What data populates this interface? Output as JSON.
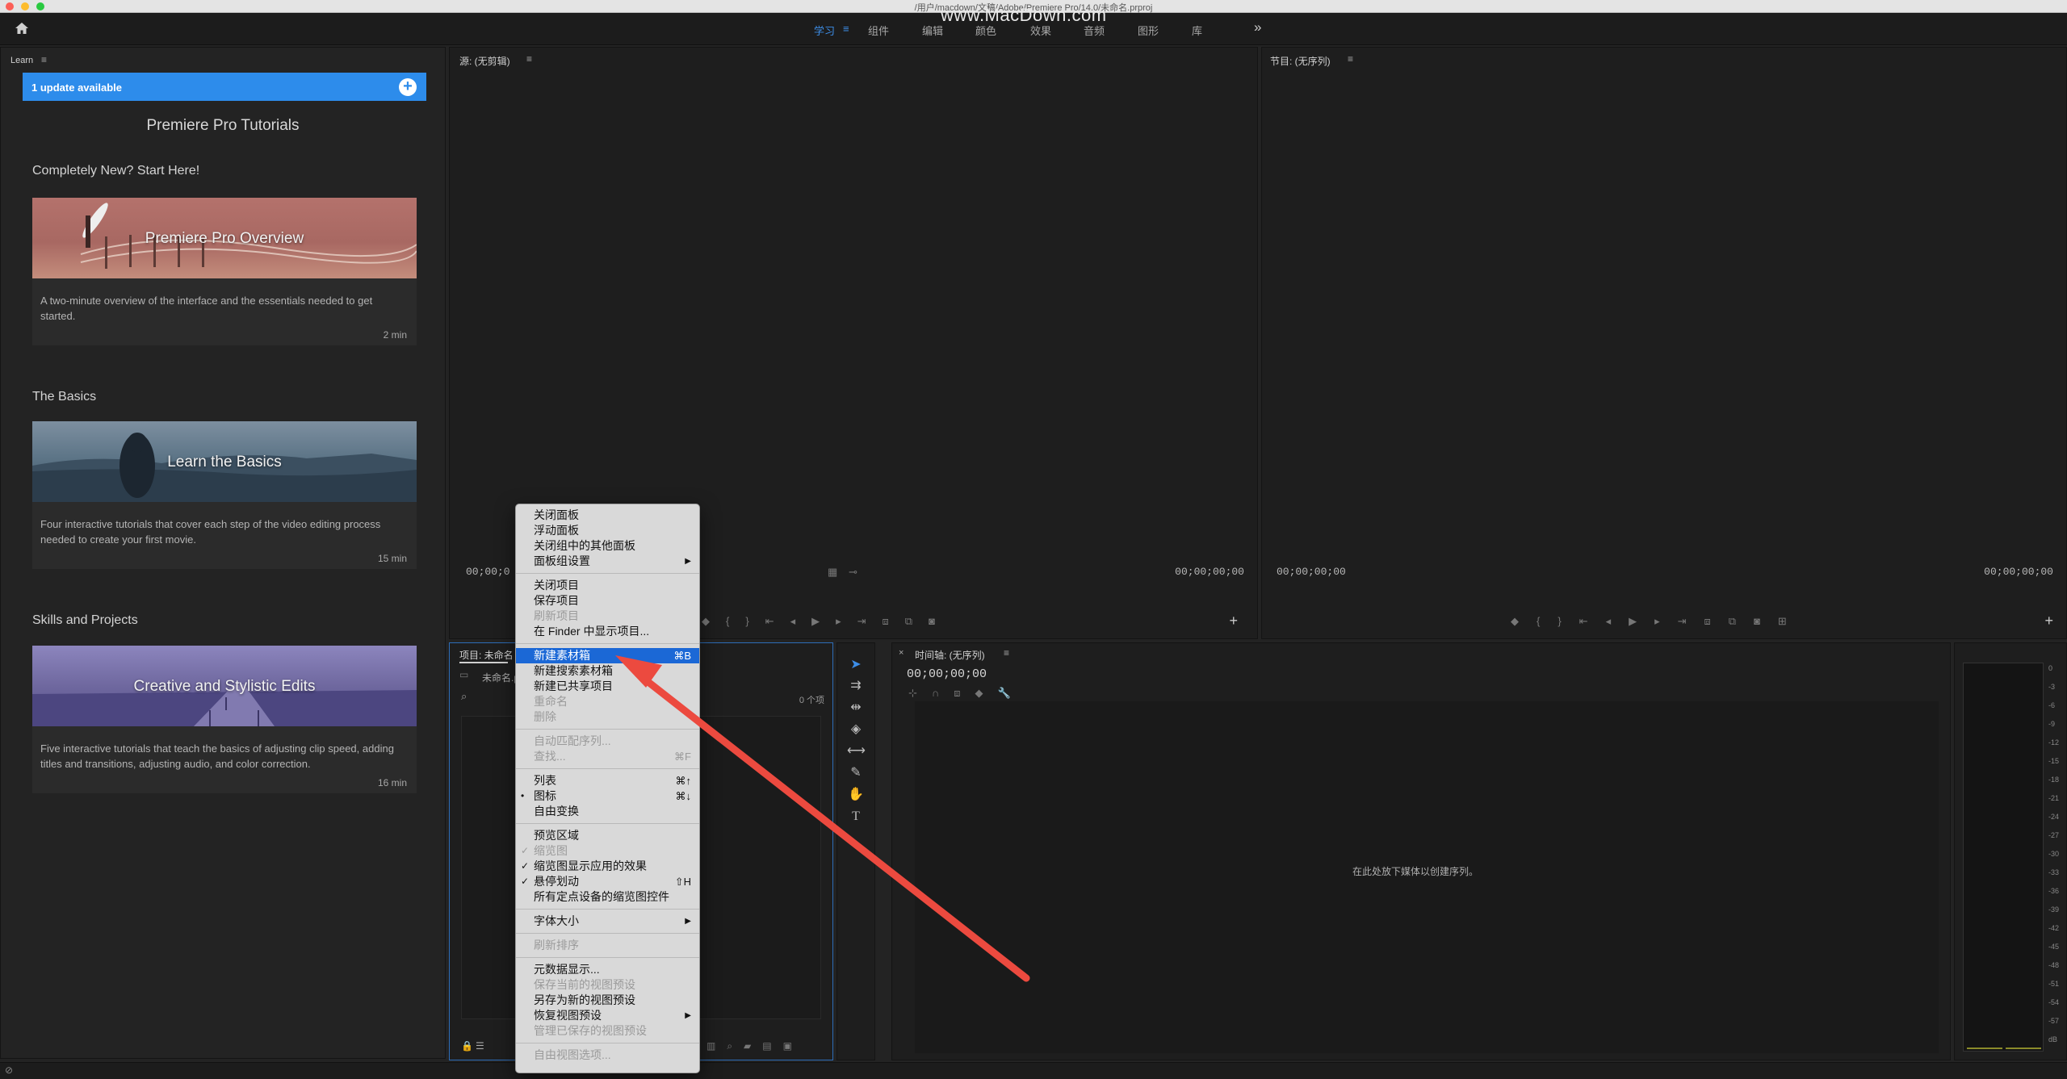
{
  "window": {
    "title": "/用户/macdown/文稿/Adobe/Premiere Pro/14.0/未命名.prproj",
    "watermark": "www.MacDown.com"
  },
  "workspaces": [
    "学习",
    "组件",
    "编辑",
    "颜色",
    "效果",
    "音频",
    "图形",
    "库"
  ],
  "workspace_menu_icon": "≡",
  "more_icon": "»",
  "learn": {
    "panel_title": "Learn",
    "update_banner": "1 update available",
    "heading": "Premiere Pro Tutorials",
    "sections": [
      {
        "title": "Completely New? Start Here!",
        "card_title": "Premiere Pro Overview",
        "desc": "A two-minute overview of the interface and the essentials needed to get started.",
        "duration": "2 min"
      },
      {
        "title": "The Basics",
        "card_title": "Learn the Basics",
        "desc": "Four interactive tutorials that cover each step of the video editing process needed to create your first movie.",
        "duration": "15 min"
      },
      {
        "title": "Skills and Projects",
        "card_title": "Creative and Stylistic Edits",
        "desc": "Five interactive tutorials that teach the basics of adjusting clip speed, adding titles and transitions, adjusting audio, and color correction.",
        "duration": "16 min"
      }
    ]
  },
  "source": {
    "title": "源: (无剪辑)",
    "tc_left": "00;00;0",
    "tc_right": "00;00;00;00"
  },
  "program": {
    "title": "节目: (无序列)",
    "tc_left": "00;00;00;00",
    "tc_right": "00;00;00;00"
  },
  "project": {
    "title": "项目: 未命名",
    "file": "未命名.p",
    "count": "0 个项"
  },
  "timeline": {
    "title": "时间轴: (无序列)",
    "tc": "00;00;00;00",
    "drop_hint": "在此处放下媒体以创建序列。"
  },
  "meter": {
    "labels": [
      "0",
      "-3",
      "-6",
      "-9",
      "-12",
      "-15",
      "-18",
      "-21",
      "-24",
      "-27",
      "-30",
      "-33",
      "-36",
      "-39",
      "-42",
      "-45",
      "-48",
      "-51",
      "-54",
      "-57",
      "dB"
    ]
  },
  "context_menu": {
    "groups": [
      [
        {
          "label": "关闭面板"
        },
        {
          "label": "浮动面板"
        },
        {
          "label": "关闭组中的其他面板"
        },
        {
          "label": "面板组设置",
          "submenu": true
        }
      ],
      [
        {
          "label": "关闭项目"
        },
        {
          "label": "保存项目"
        },
        {
          "label": "刷新项目",
          "disabled": true
        },
        {
          "label": "在 Finder 中显示项目..."
        }
      ],
      [
        {
          "label": "新建素材箱",
          "shortcut": "⌘B",
          "highlighted": true
        },
        {
          "label": "新建搜索素材箱"
        },
        {
          "label": "新建已共享项目"
        },
        {
          "label": "重命名",
          "disabled": true
        },
        {
          "label": "删除",
          "disabled": true
        }
      ],
      [
        {
          "label": "自动匹配序列...",
          "disabled": true
        },
        {
          "label": "查找...",
          "shortcut": "⌘F",
          "disabled": true
        }
      ],
      [
        {
          "label": "列表",
          "shortcut": "⌘↑"
        },
        {
          "label": "图标",
          "shortcut": "⌘↓",
          "check": "•"
        },
        {
          "label": "自由变换"
        }
      ],
      [
        {
          "label": "预览区域"
        },
        {
          "label": "缩览图",
          "check": "✓",
          "disabled": true
        },
        {
          "label": "缩览图显示应用的效果",
          "check": "✓"
        },
        {
          "label": "悬停划动",
          "shortcut": "⇧H",
          "check": "✓"
        },
        {
          "label": "所有定点设备的缩览图控件"
        }
      ],
      [
        {
          "label": "字体大小",
          "submenu": true
        }
      ],
      [
        {
          "label": "刷新排序",
          "disabled": true
        }
      ],
      [
        {
          "label": "元数据显示..."
        },
        {
          "label": "保存当前的视图预设",
          "disabled": true
        },
        {
          "label": "另存为新的视图预设"
        },
        {
          "label": "恢复视图预设",
          "submenu": true
        },
        {
          "label": "管理已保存的视图预设",
          "disabled": true
        }
      ],
      [
        {
          "label": "自由视图选项...",
          "disabled": true
        }
      ]
    ]
  },
  "colors": {
    "accent": "#2d8ceb",
    "highlight": "#1b68d6",
    "arrow": "#ec4a3f"
  }
}
